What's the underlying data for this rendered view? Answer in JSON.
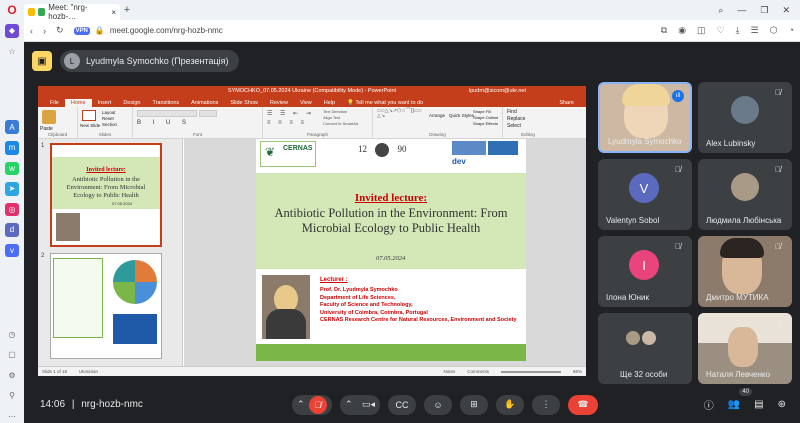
{
  "browser": {
    "tab_title": "Meet: \"nrg-hozb-…",
    "url": "meet.google.com/nrg-hozb-nmc",
    "vpn": "VPN"
  },
  "presenter": {
    "name": "Lyudmyla Symochko (Презентація)"
  },
  "ppt": {
    "title": "SYMOCHKO_07.05.2024 Ukraine (Compatibility Mode) - PowerPoint",
    "user": "lpudm@sicom@ukr.net",
    "search": "Tell me what you want to do",
    "share": "Share",
    "tabs": [
      "File",
      "Home",
      "Insert",
      "Design",
      "Transitions",
      "Animations",
      "Slide Show",
      "Review",
      "View",
      "Help"
    ],
    "groups": [
      "Clipboard",
      "Slides",
      "Font",
      "Paragraph",
      "Drawing",
      "Editing"
    ],
    "buttons": {
      "paste": "Paste",
      "new_slide": "New Slide",
      "layout": "Layout",
      "reset": "Reset",
      "section": "Section",
      "find": "Find",
      "replace": "Replace",
      "select": "Select",
      "arrange": "Arrange",
      "quick_styles": "Quick Styles",
      "shape_fill": "Shape Fill",
      "shape_outline": "Shape Outline",
      "shape_effects": "Shape Effects",
      "text_direction": "Text Direction",
      "align_text": "Align Text",
      "convert": "Convert to SmartArt"
    },
    "status": {
      "slide": "Slide 1 of 18",
      "lang": "Ukrainian",
      "notes": "Notes",
      "comments": "Comments",
      "zoom": "86%"
    },
    "thumb1": {
      "num": "1",
      "lecture": "Invited lecture:",
      "title": "Antibiotic Pollution in the Environment: From Microbial Ecology to  Public Health",
      "date": "07.05.2024"
    },
    "thumb2": {
      "num": "2"
    },
    "slide": {
      "logo": "CERNAS",
      "year": "12",
      "year2": "90",
      "dev": "dev",
      "lecture": "Invited lecture:",
      "title": "Antibiotic Pollution in the Environment: From Microbial Ecology to  Public Health",
      "date": "07.05.2024",
      "lecturer_label": "Lecturer :",
      "lines": [
        "Prof. Dr. Lyudmyla Symochko",
        "Department of Life Sciences,",
        "Faculty of Science and Technology,",
        "University of Coimbra, Coimbra,  Portugal",
        "CERNAS Research Centre for Natural Resources, Environment and Society"
      ]
    }
  },
  "participants": [
    {
      "name": "Lyudmyla Symochko",
      "type": "photo",
      "color": "#c9b8a6",
      "speaking": true
    },
    {
      "name": "Alex Lubinsky",
      "type": "photo",
      "color": "#6b7a8a"
    },
    {
      "name": "Valentyn Sobol",
      "type": "avatar",
      "initial": "V",
      "color": "#5b6abf"
    },
    {
      "name": "Людмила Любінська",
      "type": "photo",
      "color": "#a89a85"
    },
    {
      "name": "Ілона Юник",
      "type": "avatar",
      "initial": "I",
      "color": "#e8437a"
    },
    {
      "name": "Дмитро МУТИКА",
      "type": "video",
      "color": "#8c7a6a"
    },
    {
      "name": "Ще 32 особи",
      "type": "group",
      "color": "#3c4043"
    },
    {
      "name": "Наталя Левченко",
      "type": "video",
      "color": "#9b8f82"
    }
  ],
  "bottom": {
    "time": "14:06",
    "separator": "|",
    "meeting_code": "nrg-hozb-nmc",
    "people_count": "40"
  },
  "colors": {
    "accent_red": "#ea4335",
    "meet_bg": "#202124",
    "tile_bg": "#3c4043",
    "ppt_red": "#c43e1c"
  }
}
